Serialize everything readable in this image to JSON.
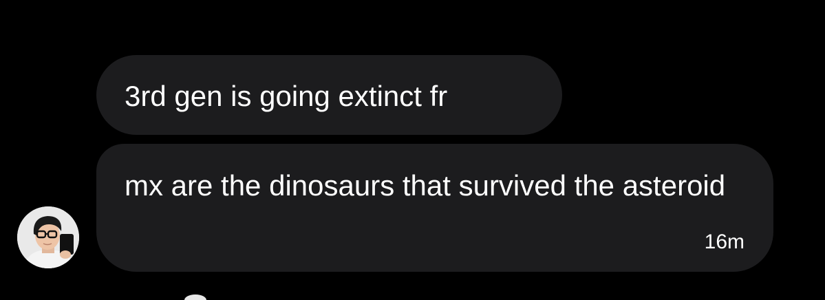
{
  "messages": [
    {
      "text": "3rd gen is going extinct fr"
    },
    {
      "text": "mx are the dinosaurs that survived the asteroid",
      "timestamp": "16m"
    }
  ],
  "sender": {
    "avatar_icon": "profile-photo-icon"
  },
  "colors": {
    "background": "#000000",
    "bubble": "#1c1c1e",
    "text": "#ffffff"
  }
}
